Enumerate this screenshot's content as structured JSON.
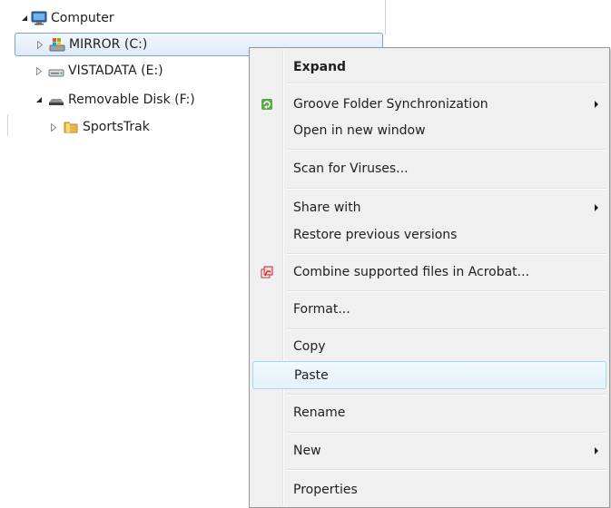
{
  "tree": {
    "nodes": [
      {
        "label": "Computer",
        "icon": "computer-icon",
        "expanded": true
      },
      {
        "label": "MIRROR (C:)",
        "icon": "windows-drive-icon",
        "expanded": false,
        "selected": true
      },
      {
        "label": "VISTADATA (E:)",
        "icon": "hard-drive-icon",
        "expanded": false
      },
      {
        "label": "Removable Disk (F:)",
        "icon": "removable-disk-icon",
        "expanded": true
      },
      {
        "label": "SportsTrak",
        "icon": "folder-icon",
        "expanded": false
      }
    ]
  },
  "menu": {
    "items": [
      {
        "label": "Expand",
        "bold": true
      },
      {
        "label": "Groove Folder Synchronization",
        "icon": "groove-icon",
        "submenu": true
      },
      {
        "label": "Open in new window"
      },
      {
        "label": "Scan for Viruses..."
      },
      {
        "label": "Share with",
        "submenu": true
      },
      {
        "label": "Restore previous versions"
      },
      {
        "label": "Combine supported files in Acrobat...",
        "icon": "acrobat-icon"
      },
      {
        "label": "Format..."
      },
      {
        "label": "Copy"
      },
      {
        "label": "Paste",
        "hovered": true
      },
      {
        "label": "Rename"
      },
      {
        "label": "New",
        "submenu": true
      },
      {
        "label": "Properties"
      }
    ]
  },
  "colors": {
    "selection_border": "#7da2ce",
    "hover_border": "#a8d8eb",
    "menu_background": "#f0f0f0"
  }
}
